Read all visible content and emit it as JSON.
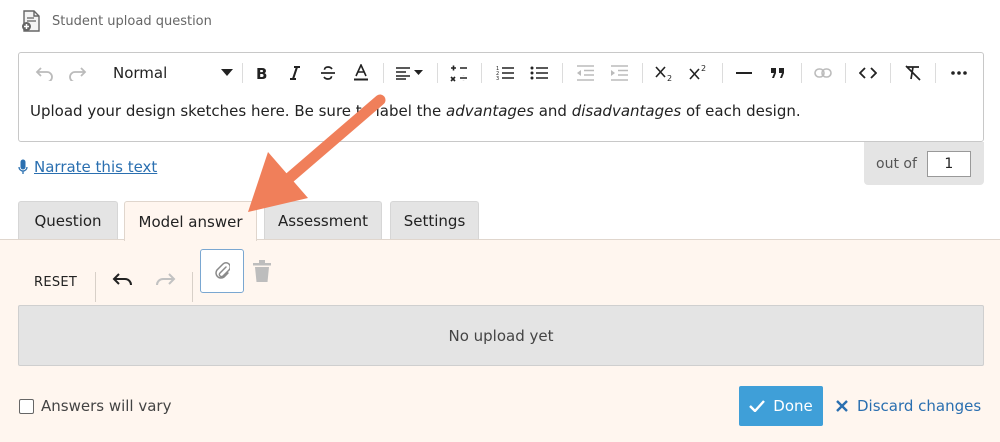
{
  "header": {
    "title": "Student upload question",
    "icon": "document-upload-icon"
  },
  "editor": {
    "format_label": "Normal",
    "body": {
      "part1": "Upload your design sketches here. Be sure to label the ",
      "em1": "advantages",
      "part2": " and ",
      "em2": "disadvantages",
      "part3": " of each design."
    },
    "toolbar_icons": [
      "undo-icon",
      "redo-icon",
      "bold-icon",
      "italic-icon",
      "strikethrough-icon",
      "text-color-icon",
      "align-icon",
      "math-formula-icon",
      "numbered-list-icon",
      "bullet-list-icon",
      "outdent-icon",
      "indent-icon",
      "subscript-icon",
      "superscript-icon",
      "horizontal-line-icon",
      "blockquote-icon",
      "link-icon",
      "code-icon",
      "clear-format-icon",
      "more-icon"
    ]
  },
  "narrate": {
    "label": "Narrate this text"
  },
  "score": {
    "label": "out of",
    "value": "1"
  },
  "tabs": [
    {
      "label": "Question",
      "active": false
    },
    {
      "label": "Model answer",
      "active": true
    },
    {
      "label": "Assessment",
      "active": false
    },
    {
      "label": "Settings",
      "active": false
    }
  ],
  "panel": {
    "reset_label": "RESET",
    "upload_placeholder": "No upload yet",
    "answers_vary_label": "Answers will vary",
    "answers_vary_checked": false,
    "done_label": "Done",
    "discard_label": "Discard changes"
  },
  "colors": {
    "accent": "#3f9fd8",
    "link": "#2a6fb0",
    "panel_bg": "#fff6ef",
    "annotation_arrow": "#f07f5a"
  }
}
